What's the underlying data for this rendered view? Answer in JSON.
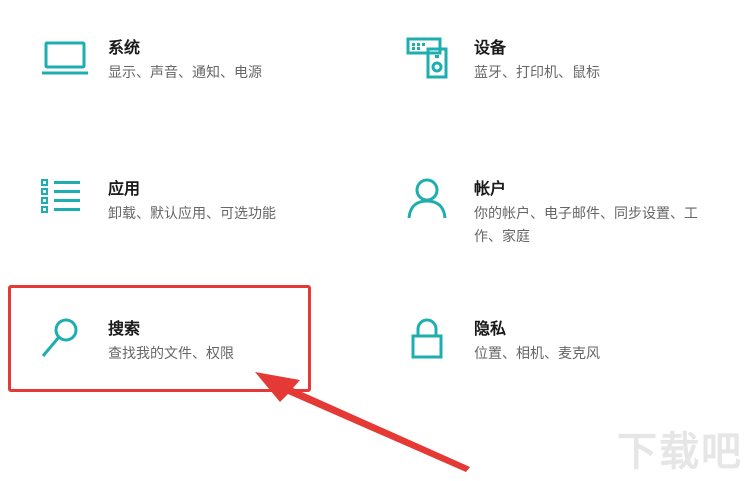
{
  "colors": {
    "accent": "#1faeb0",
    "highlight": "#e53935"
  },
  "tiles": [
    {
      "id": "system",
      "icon": "laptop-icon",
      "title": "系统",
      "desc": "显示、声音、通知、电源"
    },
    {
      "id": "devices",
      "icon": "devices-icon",
      "title": "设备",
      "desc": "蓝牙、打印机、鼠标"
    },
    {
      "id": "apps",
      "icon": "app-list-icon",
      "title": "应用",
      "desc": "卸载、默认应用、可选功能"
    },
    {
      "id": "accounts",
      "icon": "person-icon",
      "title": "帐户",
      "desc": "你的帐户、电子邮件、同步设置、工作、家庭"
    },
    {
      "id": "search",
      "icon": "search-icon",
      "title": "搜索",
      "desc": "查找我的文件、权限"
    },
    {
      "id": "privacy",
      "icon": "lock-icon",
      "title": "隐私",
      "desc": "位置、相机、麦克风"
    }
  ],
  "watermark": "下载吧"
}
